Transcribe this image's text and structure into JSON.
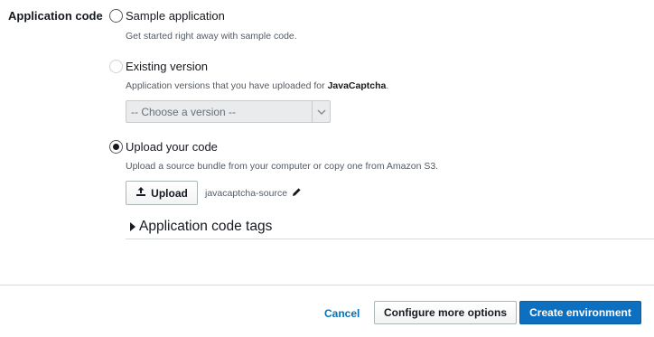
{
  "section": {
    "label": "Application code"
  },
  "options": {
    "sample": {
      "label": "Sample application",
      "description": "Get started right away with sample code."
    },
    "existing": {
      "label": "Existing version",
      "description_prefix": "Application versions that you have uploaded for ",
      "app_name": "JavaCaptcha",
      "description_suffix": "."
    },
    "upload": {
      "label": "Upload your code",
      "description": "Upload a source bundle from your computer or copy one from Amazon S3."
    }
  },
  "version_select": {
    "placeholder": "-- Choose a version --"
  },
  "upload_button": {
    "label": "Upload"
  },
  "uploaded_file": {
    "name": "javacaptcha-source"
  },
  "tags_section": {
    "label": "Application code tags"
  },
  "footer": {
    "cancel_label": "Cancel",
    "configure_label": "Configure more options",
    "create_label": "Create environment"
  },
  "selected_option": "upload",
  "colors": {
    "primary": "#0d6fc0",
    "link": "#0073bb"
  },
  "icons": {
    "upload": "upload-icon",
    "edit": "pencil-icon",
    "expand": "caret-right-icon",
    "dropdown": "chevron-down-icon"
  }
}
